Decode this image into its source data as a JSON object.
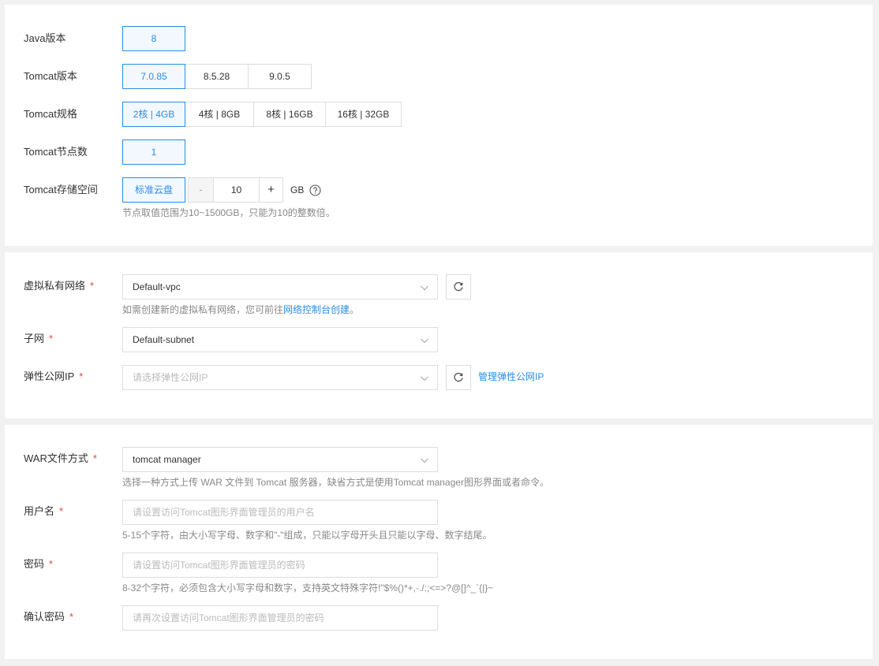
{
  "config": {
    "java": {
      "label": "Java版本",
      "options": [
        "8"
      ],
      "selected": "8"
    },
    "tomcat_version": {
      "label": "Tomcat版本",
      "options": [
        "7.0.85",
        "8.5.28",
        "9.0.5"
      ],
      "selected": "7.0.85"
    },
    "tomcat_spec": {
      "label": "Tomcat规格",
      "options": [
        "2核 | 4GB",
        "4核 | 8GB",
        "8核 | 16GB",
        "16核 | 32GB"
      ],
      "selected": "2核 | 4GB"
    },
    "node_count": {
      "label": "Tomcat节点数",
      "options": [
        "1"
      ],
      "selected": "1"
    },
    "storage": {
      "label": "Tomcat存储空间",
      "disk_type": "标准云盘",
      "minus": "-",
      "value": "10",
      "plus": "+",
      "unit": "GB",
      "help_icon": "question-circle-icon",
      "hint": "节点取值范围为10~1500GB，只能为10的整数倍。"
    }
  },
  "network": {
    "vpc": {
      "label": "虚拟私有网络",
      "required": "*",
      "value": "Default-vpc",
      "hint_prefix": "如需创建新的虚拟私有网络，您可前往",
      "hint_link": "网络控制台创建",
      "hint_suffix": "。"
    },
    "subnet": {
      "label": "子网",
      "required": "*",
      "value": "Default-subnet"
    },
    "eip": {
      "label": "弹性公网IP",
      "required": "*",
      "placeholder": "请选择弹性公网IP",
      "manage_link": "管理弹性公网IP"
    }
  },
  "deploy": {
    "war": {
      "label": "WAR文件方式",
      "required": "*",
      "value": "tomcat manager",
      "hint": "选择一种方式上传 WAR 文件到 Tomcat 服务器，缺省方式是使用Tomcat manager图形界面或者命令。"
    },
    "username": {
      "label": "用户名",
      "required": "*",
      "placeholder": "请设置访问Tomcat图形界面管理员的用户名",
      "hint": "5-15个字符，由大小写字母、数字和\"-\"组成，只能以字母开头且只能以字母、数字结尾。"
    },
    "password": {
      "label": "密码",
      "required": "*",
      "placeholder": "请设置访问Tomcat图形界面管理员的密码",
      "hint": "8-32个字符，必须包含大小写字母和数字，支持英文特殊字符!\"$%()*+,-./:;<=>?@[]^_`{|}~"
    },
    "confirm": {
      "label": "确认密码",
      "required": "*",
      "placeholder": "请再次设置访问Tomcat图形界面管理员的密码"
    }
  },
  "colors": {
    "accent": "#2b8ce6",
    "required": "#e54545",
    "border": "#dddddd",
    "selected_bg": "#f2f8fe",
    "page_bg": "#f1f1f1"
  }
}
